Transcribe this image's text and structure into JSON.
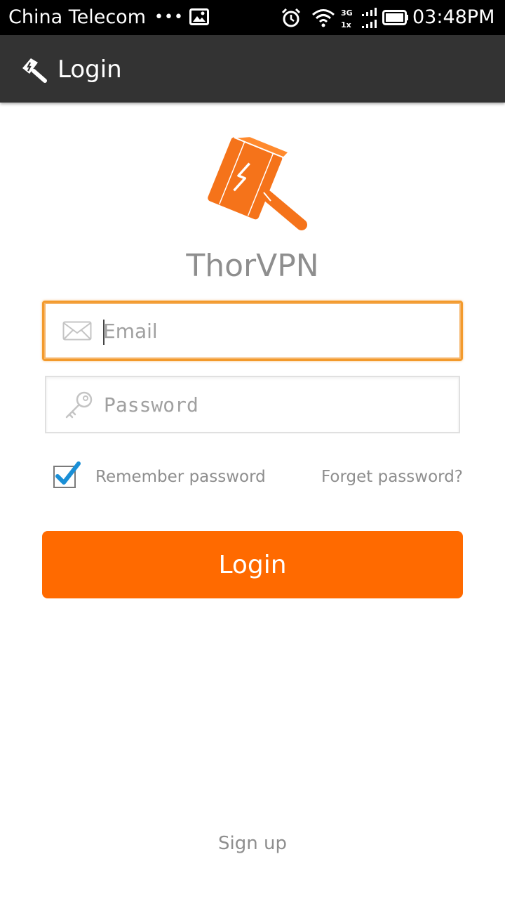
{
  "status_bar": {
    "carrier": "China Telecom",
    "dots": "•••",
    "network_label_top": "3G",
    "network_label_bottom": "1x",
    "time": "03:48PM",
    "icons": [
      "image-icon",
      "alarm-icon",
      "wifi-icon",
      "signal-icon",
      "battery-icon"
    ]
  },
  "app_bar": {
    "title": "Login",
    "icon": "hammer-icon"
  },
  "brand": {
    "name": "ThorVPN",
    "logo": "hammer-logo",
    "accent": "#ff6a00"
  },
  "form": {
    "email": {
      "placeholder": "Email",
      "value": ""
    },
    "password": {
      "placeholder": "Password",
      "value": ""
    },
    "remember_label": "Remember password",
    "remember_checked": true,
    "forget_label": "Forget password?",
    "login_label": "Login"
  },
  "footer": {
    "signup_label": "Sign up"
  },
  "colors": {
    "status_bar_bg": "#000000",
    "app_bar_bg": "#333333",
    "primary": "#ff6a00",
    "focus_border": "#f39a2c",
    "muted_text": "#8e8e8e",
    "check_blue": "#1a8fd6"
  }
}
